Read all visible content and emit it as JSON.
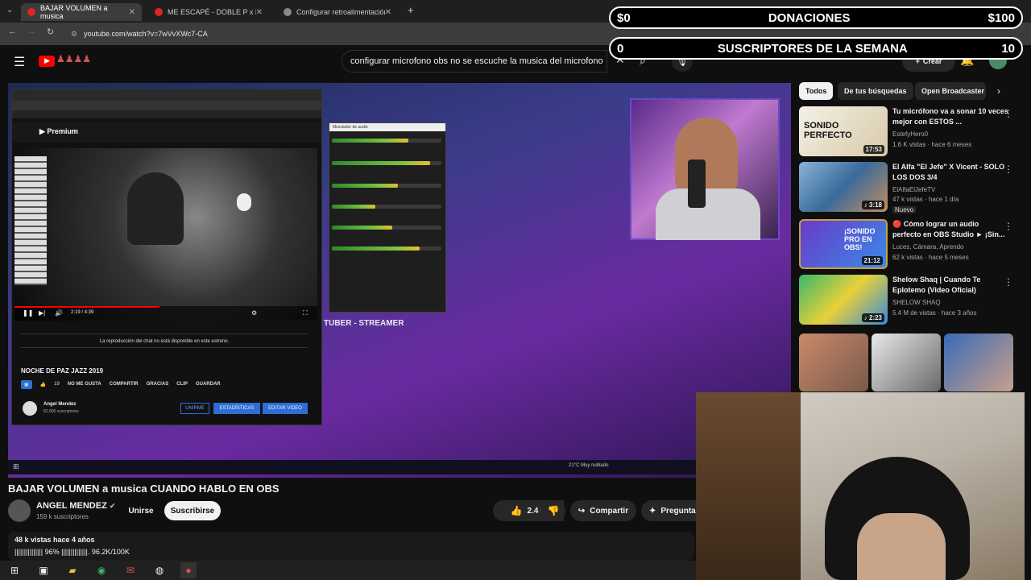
{
  "browser": {
    "tabs": [
      {
        "label": "BAJAR VOLUMEN a musica",
        "active": true
      },
      {
        "label": "ME ESCAPÉ - DOBLE P x LAUTY",
        "active": false
      },
      {
        "label": "Configurar retroalimentación m",
        "active": false
      }
    ],
    "new_tab": "+",
    "url": "youtube.com/watch?v=7wVvXWc7-CA"
  },
  "youtube": {
    "search_value": "configurar microfono obs no se escuche la musica del microfono",
    "create_label": "Crear"
  },
  "overlay": {
    "donations": {
      "left": "$0",
      "label": "DONACIONES",
      "right": "$100"
    },
    "subs": {
      "left": "0",
      "label": "SUSCRIPTORES DE LA SEMANA",
      "right": "10"
    }
  },
  "inner_video": {
    "chat_notice": "La reproducción del chat no está disponible en este estreno.",
    "title": "NOCHE DE PAZ JAZZ 2019",
    "time": "2:19 / 4:39",
    "likes": "19",
    "dislike_label": "NO ME GUSTA",
    "actions": [
      "COMPARTIR",
      "GRACIAS",
      "CLIP",
      "GUARDAR"
    ],
    "channel": "Angel Mendez",
    "subs": "82.800 suscriptores",
    "buttons": [
      "UNIRME",
      "ESTADÍSTICAS",
      "EDITAR VIDEO"
    ],
    "mixer_title": "Mezclador de audio",
    "tag_line": "TUBER - STREAMER",
    "weather": "21°C Muy nublado"
  },
  "video": {
    "title": "BAJAR VOLUMEN a musica CUANDO HABLO EN OBS",
    "channel": "ANGEL MENDEZ",
    "subs": "159 k suscriptores",
    "join": "Unirse",
    "subscribe": "Suscribirse",
    "likes": "2.4 K",
    "share": "Compartir",
    "ask": "Preguntar",
    "views": "48 k vistas  hace 4 años",
    "progress_text": "||||||||||||||| 96% ||||||||||||||. 96.2K/100K"
  },
  "sidebar": {
    "chips": [
      "Todos",
      "De tus búsquedas",
      "Open Broadcaster S"
    ],
    "recs": [
      {
        "title": "Tu micrófono va a sonar 10 veces mejor con ESTOS ...",
        "channel": "EstefyHero0",
        "meta": "1.6 K vistas · hace 6 meses",
        "duration": "17:53",
        "thumb_text": "SONIDO PERFECTO"
      },
      {
        "title": "El Alfa \"El Jefe\" X Vicent - SOLO LOS DOS 3/4",
        "channel": "ElAlfaElJefeTV",
        "meta": "47 k vistas · hace 1 día",
        "badge": "Nuevo",
        "duration": "♪ 3:18"
      },
      {
        "title": "🔴 Cómo lograr un audio perfecto en OBS Studio ► ¡Sin...",
        "channel": "Luces, Cámara, Aprendo",
        "meta": "62 k vistas · hace 5 meses",
        "duration": "21:12",
        "thumb_text": "¡SONIDO PRO EN OBS!"
      },
      {
        "title": "Shelow Shaq | Cuando Te Eplotemo (Video Oficial)",
        "channel": "SHELOW SHAQ",
        "meta": "5.4 M de vistas · hace 3 años",
        "duration": "♪ 2:23"
      }
    ]
  }
}
